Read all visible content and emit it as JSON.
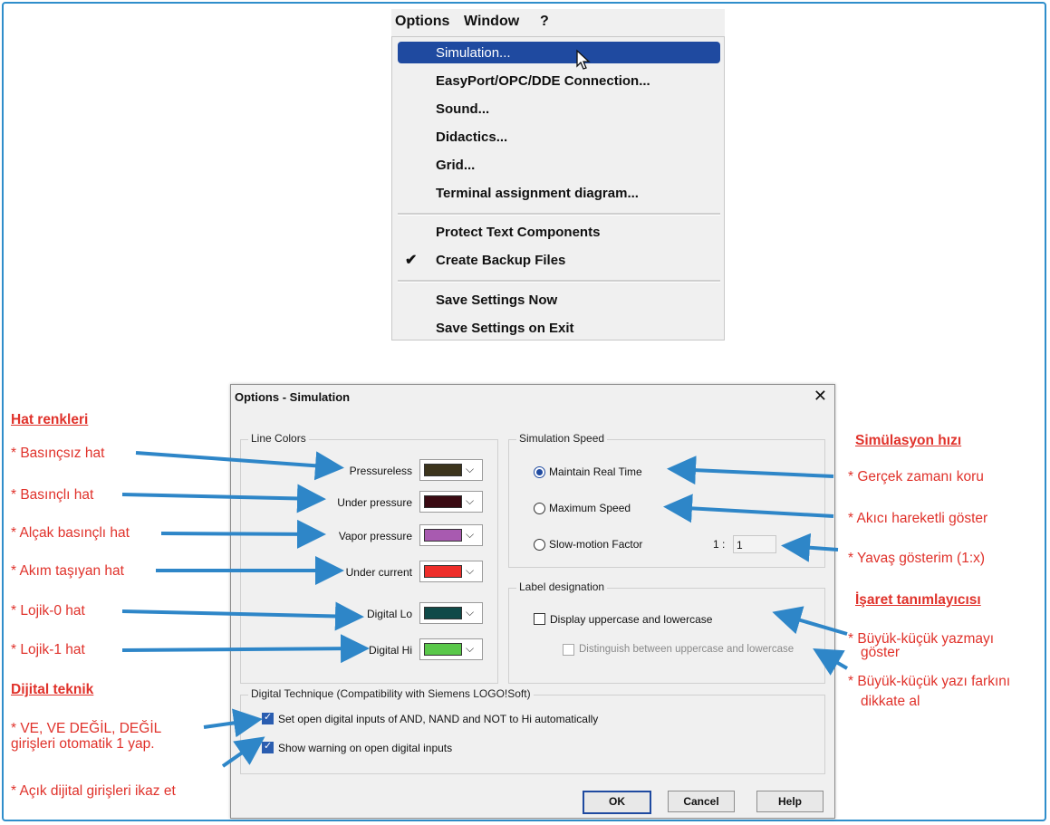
{
  "menubar": {
    "options": "Options",
    "window": "Window",
    "help": "?"
  },
  "menu": {
    "simulation": "Simulation...",
    "easyport": "EasyPort/OPC/DDE Connection...",
    "sound": "Sound...",
    "didactics": "Didactics...",
    "grid": "Grid...",
    "terminal": "Terminal assignment diagram...",
    "protect": "Protect Text Components",
    "backup": "Create Backup Files",
    "save_now": "Save Settings Now",
    "save_exit": "Save Settings on Exit"
  },
  "dialog": {
    "title": "Options - Simulation",
    "line_colors": {
      "title": "Line Colors",
      "items": [
        {
          "label": "Pressureless",
          "color": "#3d351d"
        },
        {
          "label": "Under pressure",
          "color": "#3a0a12"
        },
        {
          "label": "Vapor pressure",
          "color": "#a85ab0"
        },
        {
          "label": "Under current",
          "color": "#ee2e2a"
        },
        {
          "label": "Digital Lo",
          "color": "#0f4a48"
        },
        {
          "label": "Digital Hi",
          "color": "#5ac84a"
        }
      ]
    },
    "speed": {
      "title": "Simulation Speed",
      "real_time": "Maintain Real Time",
      "max_speed": "Maximum Speed",
      "slow_motion": "Slow-motion Factor",
      "ratio_prefix": "1 :",
      "factor": "1"
    },
    "label": {
      "title": "Label designation",
      "display_case": "Display uppercase and lowercase",
      "distinguish": "Distinguish between uppercase and lowercase"
    },
    "digital": {
      "title": "Digital Technique (Compatibility with Siemens LOGO!Soft)",
      "open_inputs": "Set open digital inputs of AND, NAND and NOT to Hi automatically",
      "warning": "Show warning on open digital inputs"
    },
    "buttons": {
      "ok": "OK",
      "cancel": "Cancel",
      "help": "Help"
    }
  },
  "annotations": {
    "hat_renkleri": "Hat renkleri",
    "basincsiz": "* Basınçsız hat",
    "basincli": "* Basınçlı hat",
    "alcak": "* Alçak basınçlı hat",
    "akim": "* Akım taşıyan hat",
    "lojik0": "* Lojik-0 hat",
    "lojik1": "* Lojik-1 hat",
    "dijital_teknik": "Dijital teknik",
    "ve_line1": "* VE, VE DEĞİL, DEĞİL",
    "ve_line2": "girişleri otomatik 1 yap.",
    "acik": "* Açık dijital girişleri ikaz et",
    "sim_hizi": "Simülasyon hızı",
    "gercek": "* Gerçek zamanı koru",
    "akici": "* Akıcı hareketli göster",
    "yavas": "* Yavaş gösterim (1:x)",
    "isaret": "İşaret tanımlayıcısı",
    "buyuk1_line1": "* Büyük-küçük yazmayı",
    "buyuk1_line2": "göster",
    "buyuk2_line1": "* Büyük-küçük yazı farkını",
    "buyuk2_line2": "dikkate al"
  }
}
